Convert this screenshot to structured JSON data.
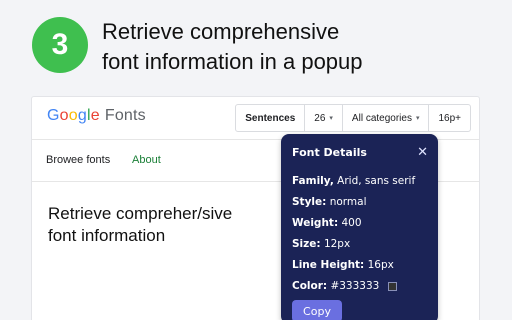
{
  "step": {
    "number": "3"
  },
  "headline": {
    "line1": "Retrieve comprehensive",
    "line2": "font information in a popup"
  },
  "site": {
    "logo": {
      "g1": "G",
      "o1": "o",
      "o2": "o",
      "g2": "g",
      "l": "l",
      "e": "e",
      "fonts": "Fonts"
    },
    "toolbar": {
      "preview_mode": "Sentences",
      "size": "26",
      "category": "All categories",
      "language": "16p+"
    },
    "nav": {
      "browse": "Browee fonts",
      "about": "About"
    },
    "sample": {
      "line1": "Retrieve compreher/sive",
      "line2": "font information"
    }
  },
  "popup": {
    "title": "Font Details",
    "rows": [
      {
        "key": "Family",
        "value": "Arid, sans serif",
        "key_sep": ","
      },
      {
        "key": "Style:",
        "value": "normal"
      },
      {
        "key": "Weight:",
        "value": "400"
      },
      {
        "key": "Size:",
        "value": "12px"
      },
      {
        "key": "Line Height:",
        "value": "16px"
      },
      {
        "key": "Color:",
        "value": "#333333"
      }
    ],
    "copy_label": "Copy",
    "close_glyph": "✕"
  },
  "colors": {
    "badge": "#3fbf4f",
    "popup_bg": "#1b2356",
    "copy_button": "#6a6fe0",
    "about_link": "#1a7f37",
    "google_blue": "#4285f4",
    "google_red": "#ea4335",
    "google_yellow": "#fbbc05",
    "google_green": "#34a853",
    "font_color_swatch": "#333333"
  },
  "icons": {
    "close": "close-icon",
    "dropdown": "chevron-down-icon",
    "swatch": "color-swatch-icon"
  }
}
